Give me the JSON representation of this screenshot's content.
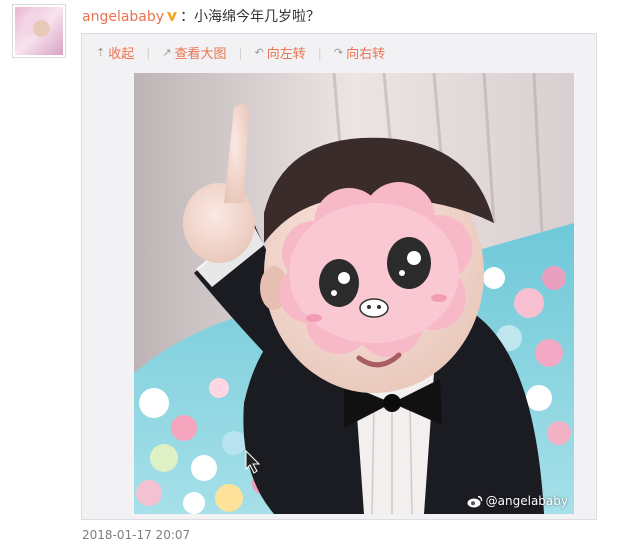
{
  "post": {
    "username": "angelababy",
    "text": "：小海绵今年几岁啦？",
    "timestamp": "2018-01-17 20:07"
  },
  "toolbar": {
    "collapse_label": "收起",
    "view_large_label": "查看大图",
    "rotate_left_label": "向左转",
    "rotate_right_label": "向右转"
  },
  "image": {
    "watermark": "@angelababy"
  },
  "icons": [
    "avatar",
    "verified-v-badge",
    "collapse-icon",
    "open-large-icon",
    "rotate-left-icon",
    "rotate-right-icon",
    "weibo-logo-icon"
  ],
  "colors": {
    "username": "#eb7350",
    "link": "#eb7350",
    "badge": "#f5a623",
    "timestamp": "#808080"
  }
}
